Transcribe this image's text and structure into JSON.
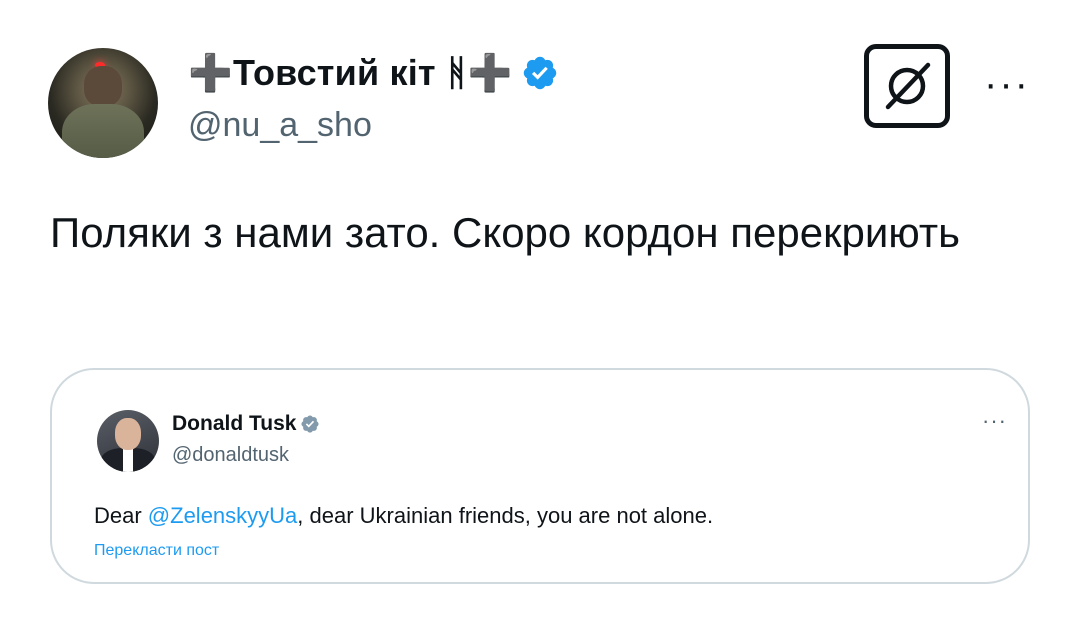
{
  "author": {
    "display_name": "➕Товстий кіт ᚻ➕",
    "handle": "@nu_a_sho",
    "avatar_icon": "avatar-photo",
    "verified_icon": "verified-badge-icon"
  },
  "actions": {
    "grok_icon": "grok-icon",
    "more_label": "···"
  },
  "tweet": {
    "text": "Поляки з нами зато. Скоро кордон перекриють"
  },
  "quoted": {
    "display_name": "Donald Tusk",
    "handle": "@donaldtusk",
    "more_label": "···",
    "text_prefix": "Dear ",
    "mention": "@ZelenskyyUa",
    "text_suffix": ", dear Ukrainian friends, you are not alone.",
    "translate_label": "Перекласти пост"
  },
  "colors": {
    "accent": "#1d9bf0",
    "text": "#0f1419",
    "muted": "#536471",
    "border": "#cfd9de"
  }
}
